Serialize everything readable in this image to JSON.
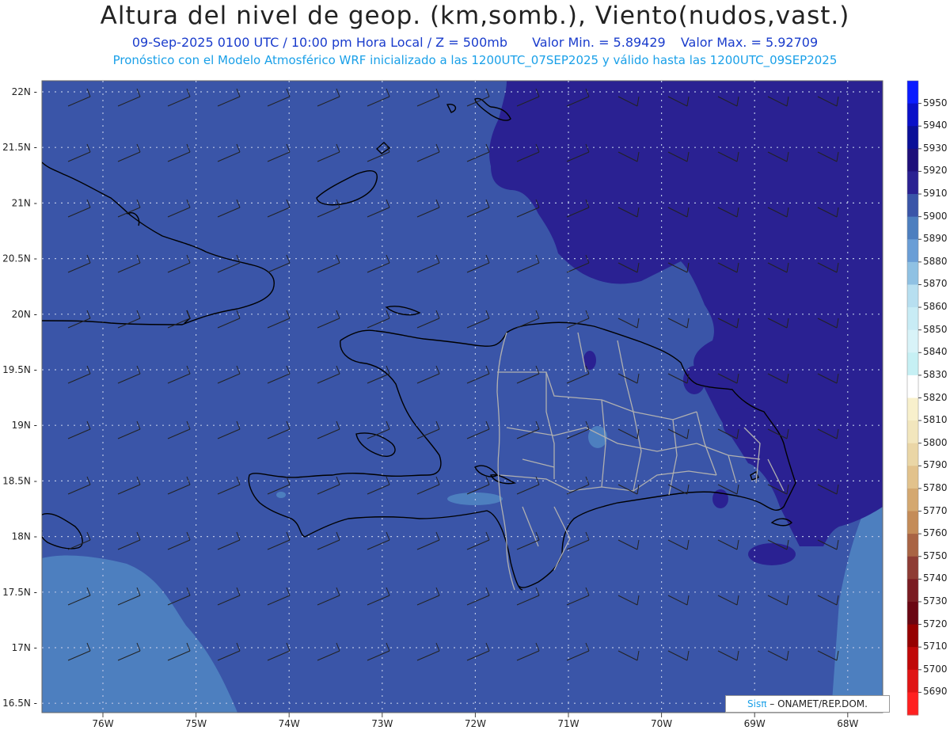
{
  "title": "Altura del nivel de geop. (km,somb.), Viento(nudos,vast.)",
  "subtitle": {
    "datetime": "09-Sep-2025 0100 UTC / 10:00 pm Hora Local / Z = 500mb",
    "min": "Valor Min. = 5.89429",
    "max": "Valor Max. = 5.92709"
  },
  "model_line": "Pronóstico con el Modelo Atmosférico WRF inicializado a las 1200UTC_07SEP2025 y válido hasta las 1200UTC_09SEP2025",
  "credit": {
    "sis": "Sisπ",
    "org": "– ONAMET/REP.DOM."
  },
  "lat_labels": [
    "22N",
    "21.5N",
    "21N",
    "20.5N",
    "20N",
    "19.5N",
    "19N",
    "18.5N",
    "18N",
    "17.5N",
    "17N",
    "16.5N"
  ],
  "lon_labels": [
    "76W",
    "75W",
    "74W",
    "73W",
    "72W",
    "71W",
    "70W",
    "69W",
    "68W"
  ],
  "colorbar": {
    "labels": [
      "5950",
      "5940",
      "5930",
      "5920",
      "5910",
      "5900",
      "5890",
      "5880",
      "5870",
      "5860",
      "5850",
      "5840",
      "5830",
      "5820",
      "5810",
      "5800",
      "5790",
      "5780",
      "5770",
      "5760",
      "5750",
      "5740",
      "5730",
      "5720",
      "5710",
      "5700",
      "5690"
    ],
    "colors": [
      "#0b1cff",
      "#0a10c8",
      "#0a0f98",
      "#1e0f7a",
      "#2a2192",
      "#3a55a8",
      "#4d7fbf",
      "#6a9ed6",
      "#8fc1e3",
      "#b7dff0",
      "#c8ecf5",
      "#d8f3f8",
      "#c6f0f4",
      "#ffffff",
      "#f8f0cc",
      "#f2e6bd",
      "#ead6a6",
      "#e2c28c",
      "#d4a870",
      "#c48c58",
      "#a96444",
      "#8e3c34",
      "#7a1c22",
      "#6a0612",
      "#960000",
      "#c00808",
      "#e01414",
      "#ff2020"
    ]
  },
  "colors": {
    "level_5900": "#3a55a8",
    "level_5910": "#2a2192",
    "level_5890": "#4d7fbf",
    "coast": "#000000",
    "borders": "#b0b0b0"
  }
}
